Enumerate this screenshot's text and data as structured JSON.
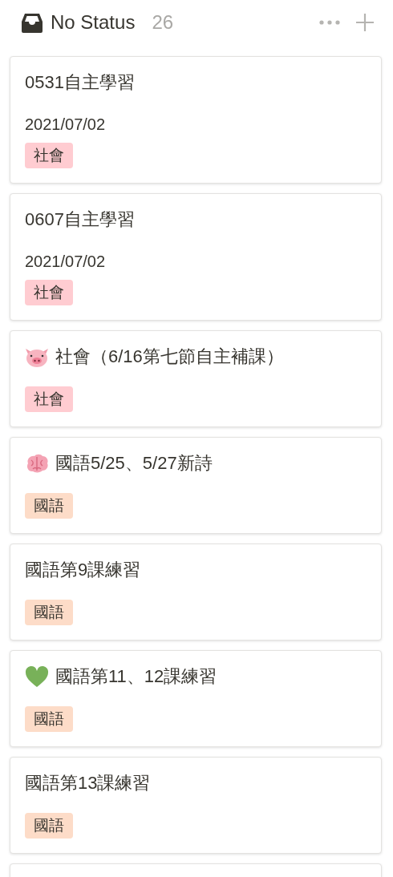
{
  "column": {
    "title": "No Status",
    "count": "26"
  },
  "cards": [
    {
      "title": "0531自主學習",
      "date": "2021/07/02",
      "tags": [
        {
          "label": "社會",
          "color": "#ffccd1"
        }
      ]
    },
    {
      "title": "0607自主學習",
      "date": "2021/07/02",
      "tags": [
        {
          "label": "社會",
          "color": "#ffccd1"
        }
      ]
    },
    {
      "kind": "pig",
      "title": "社會（6/16第七節自主補課）",
      "tags": [
        {
          "label": "社會",
          "color": "#ffccd1"
        }
      ]
    },
    {
      "kind": "brain",
      "title": "國語5/25、5/27新詩",
      "tags": [
        {
          "label": "國語",
          "color": "#fddcc8"
        }
      ]
    },
    {
      "title": "國語第9課練習",
      "tags": [
        {
          "label": "國語",
          "color": "#fddcc8"
        }
      ]
    },
    {
      "kind": "heart",
      "title": "國語第11、12課練習",
      "tags": [
        {
          "label": "國語",
          "color": "#fddcc8"
        }
      ]
    },
    {
      "title": "國語第13課練習",
      "tags": [
        {
          "label": "國語",
          "color": "#fddcc8"
        }
      ]
    }
  ]
}
